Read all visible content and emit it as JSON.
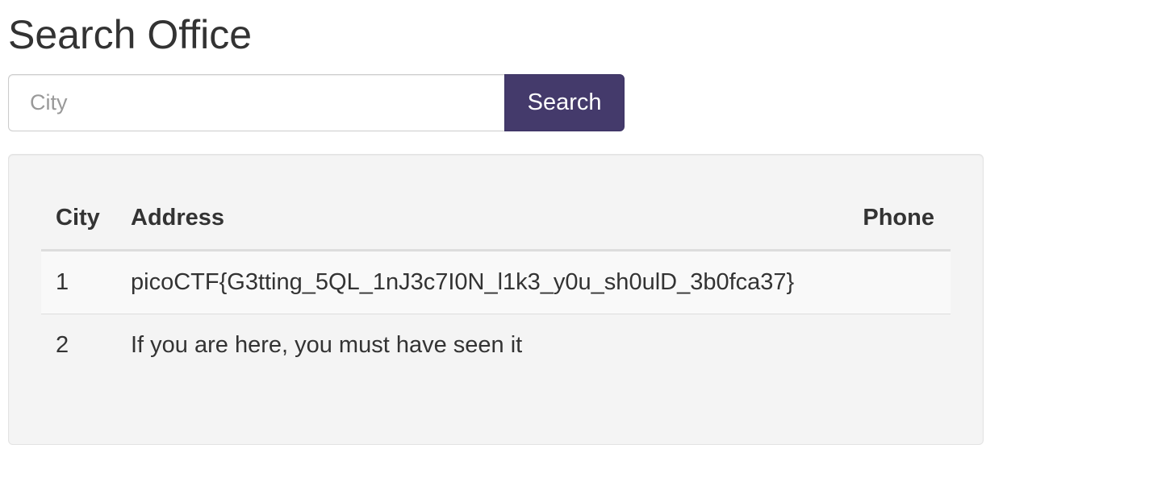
{
  "page": {
    "title": "Search Office"
  },
  "search": {
    "placeholder": "City",
    "value": "",
    "button_label": "Search"
  },
  "colors": {
    "button_background": "#443a6b",
    "panel_background": "#f4f4f4",
    "text": "#333333"
  },
  "table": {
    "columns": [
      "City",
      "Address",
      "Phone"
    ],
    "rows": [
      {
        "city": "1",
        "address": "picoCTF{G3tting_5QL_1nJ3c7I0N_l1k3_y0u_sh0ulD_3b0fca37}",
        "phone": ""
      },
      {
        "city": "2",
        "address": "If you are here, you must have seen it",
        "phone": ""
      }
    ]
  }
}
